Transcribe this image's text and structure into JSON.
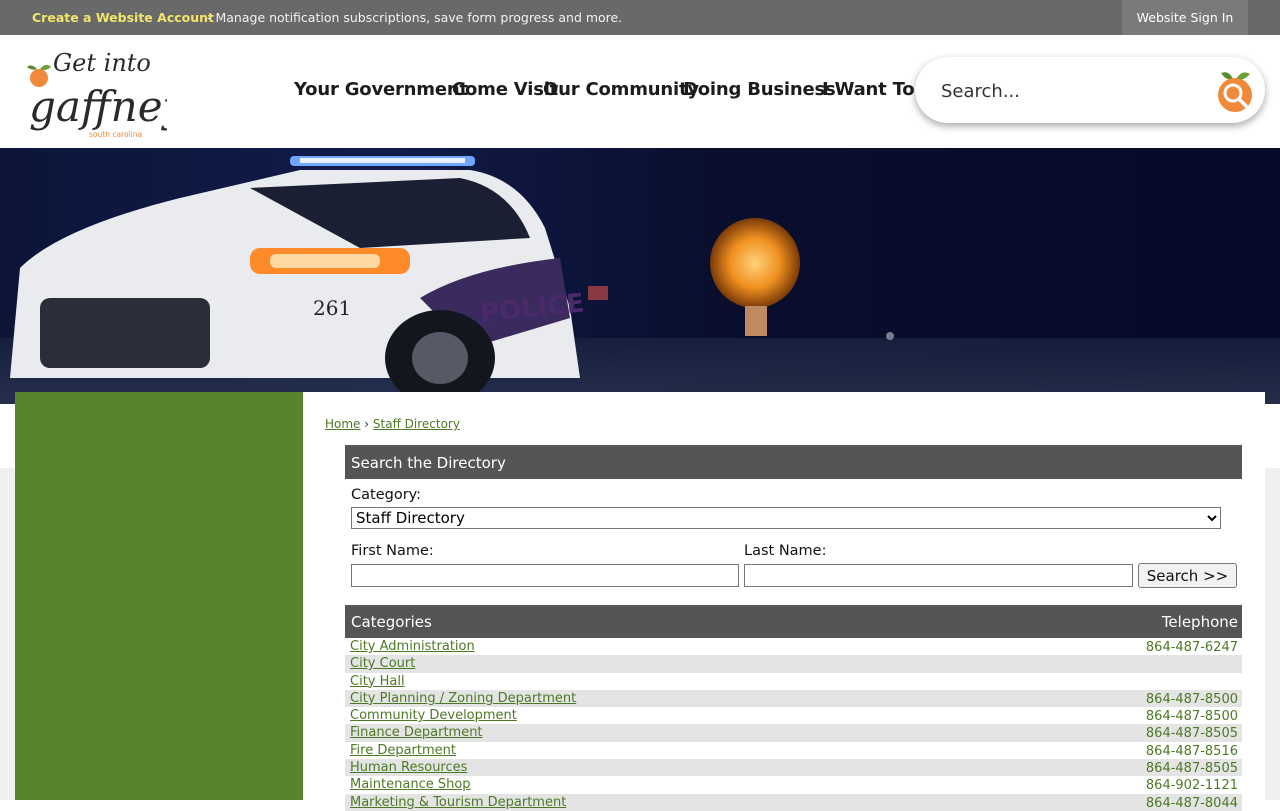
{
  "topbar": {
    "create_account": "Create a Website Account",
    "message": "- Manage notification subscriptions, save form progress and more.",
    "sign_in": "Website Sign In"
  },
  "header": {
    "logo_text": "Get into gaffney",
    "logo_subtext": "south carolina",
    "nav": [
      "Your Government",
      "Come Visit",
      "Our Community",
      "Doing Business",
      "I Want To..."
    ],
    "search_placeholder": "Search..."
  },
  "hero": {
    "vehicle_number": "261",
    "vehicle_text": "POLICE"
  },
  "breadcrumb": {
    "home": "Home",
    "separator": "›",
    "current": "Staff Directory"
  },
  "search_panel": {
    "title": "Search the Directory",
    "category_label": "Category:",
    "category_value": "Staff Directory",
    "first_name_label": "First Name:",
    "last_name_label": "Last Name:",
    "search_button": "Search >>"
  },
  "categories_table": {
    "headers": {
      "name": "Categories",
      "telephone": "Telephone"
    },
    "rows": [
      {
        "name": "City Administration",
        "telephone": "864-487-6247"
      },
      {
        "name": "City Court",
        "telephone": ""
      },
      {
        "name": "City Hall",
        "telephone": ""
      },
      {
        "name": "City Planning / Zoning Department",
        "telephone": "864-487-8500"
      },
      {
        "name": "Community Development",
        "telephone": "864-487-8500"
      },
      {
        "name": "Finance Department",
        "telephone": "864-487-8505"
      },
      {
        "name": "Fire Department",
        "telephone": "864-487-8516"
      },
      {
        "name": "Human Resources",
        "telephone": "864-487-8505"
      },
      {
        "name": "Maintenance Shop",
        "telephone": "864-902-1121"
      },
      {
        "name": "Marketing & Tourism Department",
        "telephone": "864-487-8044"
      }
    ]
  },
  "colors": {
    "accent_green": "#5a842c",
    "link_green": "#4c7a24",
    "header_gray": "#555555",
    "topbar_gray": "#696969",
    "create_account_yellow": "#f3e46a",
    "peach_orange": "#f0893a"
  }
}
